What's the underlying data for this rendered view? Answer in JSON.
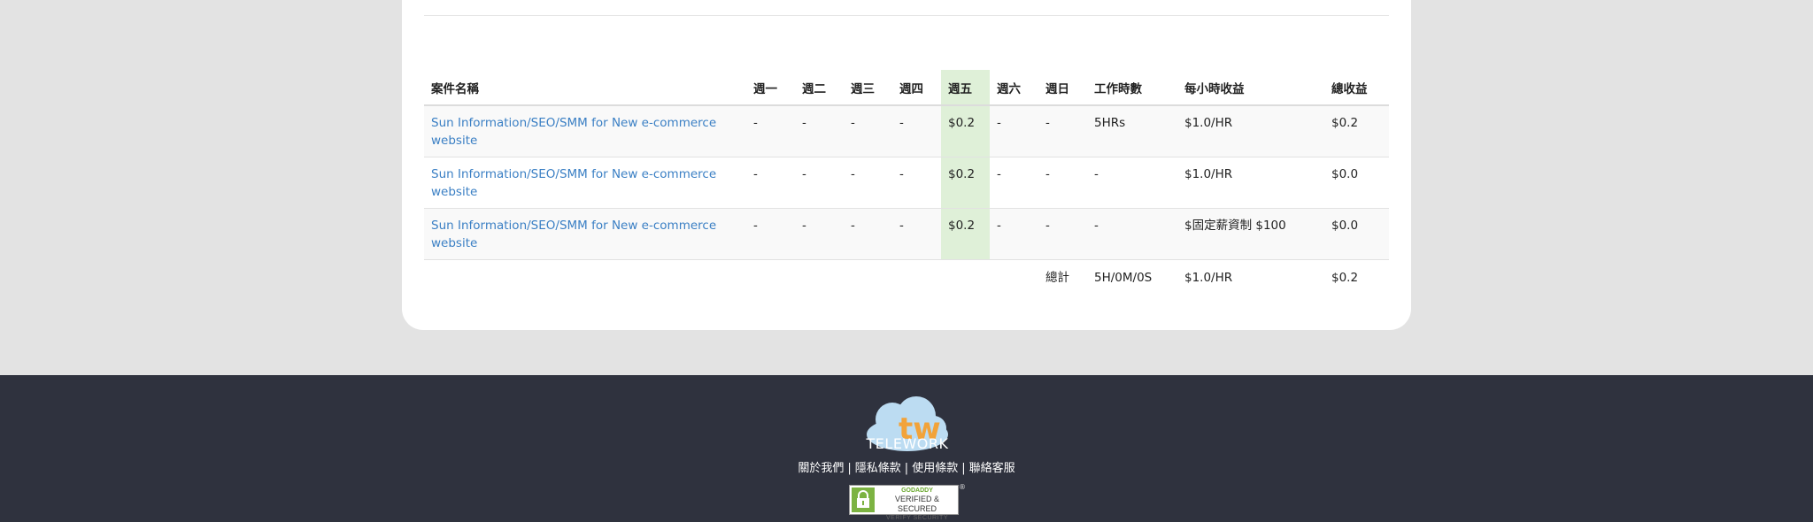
{
  "table": {
    "headers": {
      "name": "案件名稱",
      "mon": "週一",
      "tue": "週二",
      "wed": "週三",
      "thu": "週四",
      "fri": "週五",
      "sat": "週六",
      "sun": "週日",
      "hours": "工作時數",
      "rate": "每小時收益",
      "total": "總收益"
    },
    "rows": [
      {
        "project": "Sun Information/SEO/SMM for New e-commerce website",
        "mon": "-",
        "tue": "-",
        "wed": "-",
        "thu": "-",
        "fri": "$0.2",
        "sat": "-",
        "sun": "-",
        "hours": "5HRs",
        "rate": "$1.0/HR",
        "total": "$0.2"
      },
      {
        "project": "Sun Information/SEO/SMM for New e-commerce website",
        "mon": "-",
        "tue": "-",
        "wed": "-",
        "thu": "-",
        "fri": "$0.2",
        "sat": "-",
        "sun": "-",
        "hours": "-",
        "rate": "$1.0/HR",
        "total": "$0.0"
      },
      {
        "project": "Sun Information/SEO/SMM for New e-commerce website",
        "mon": "-",
        "tue": "-",
        "wed": "-",
        "thu": "-",
        "fri": "$0.2",
        "sat": "-",
        "sun": "-",
        "hours": "-",
        "rate": "$固定薪資制 $100",
        "total": "$0.0"
      }
    ],
    "summary": {
      "label": "總計",
      "hours": "5H/0M/0S",
      "rate": "$1.0/HR",
      "total": "$0.2"
    }
  },
  "footer": {
    "logo_letters": "tw",
    "logo_text": "TELEWORK",
    "links": [
      "關於我們",
      "隱私條款",
      "使用條款",
      "聯絡客服"
    ],
    "separator": "|",
    "seal": {
      "brand": "GODADDY",
      "main": "VERIFIED & SECURED",
      "sub": "VERIFY SECURITY",
      "mark": "®"
    }
  },
  "colors": {
    "page_bg": "#e3e3e3",
    "footer_bg": "#2f323e",
    "link": "#3a7fc4",
    "today_highlight": "#dff0d8"
  }
}
